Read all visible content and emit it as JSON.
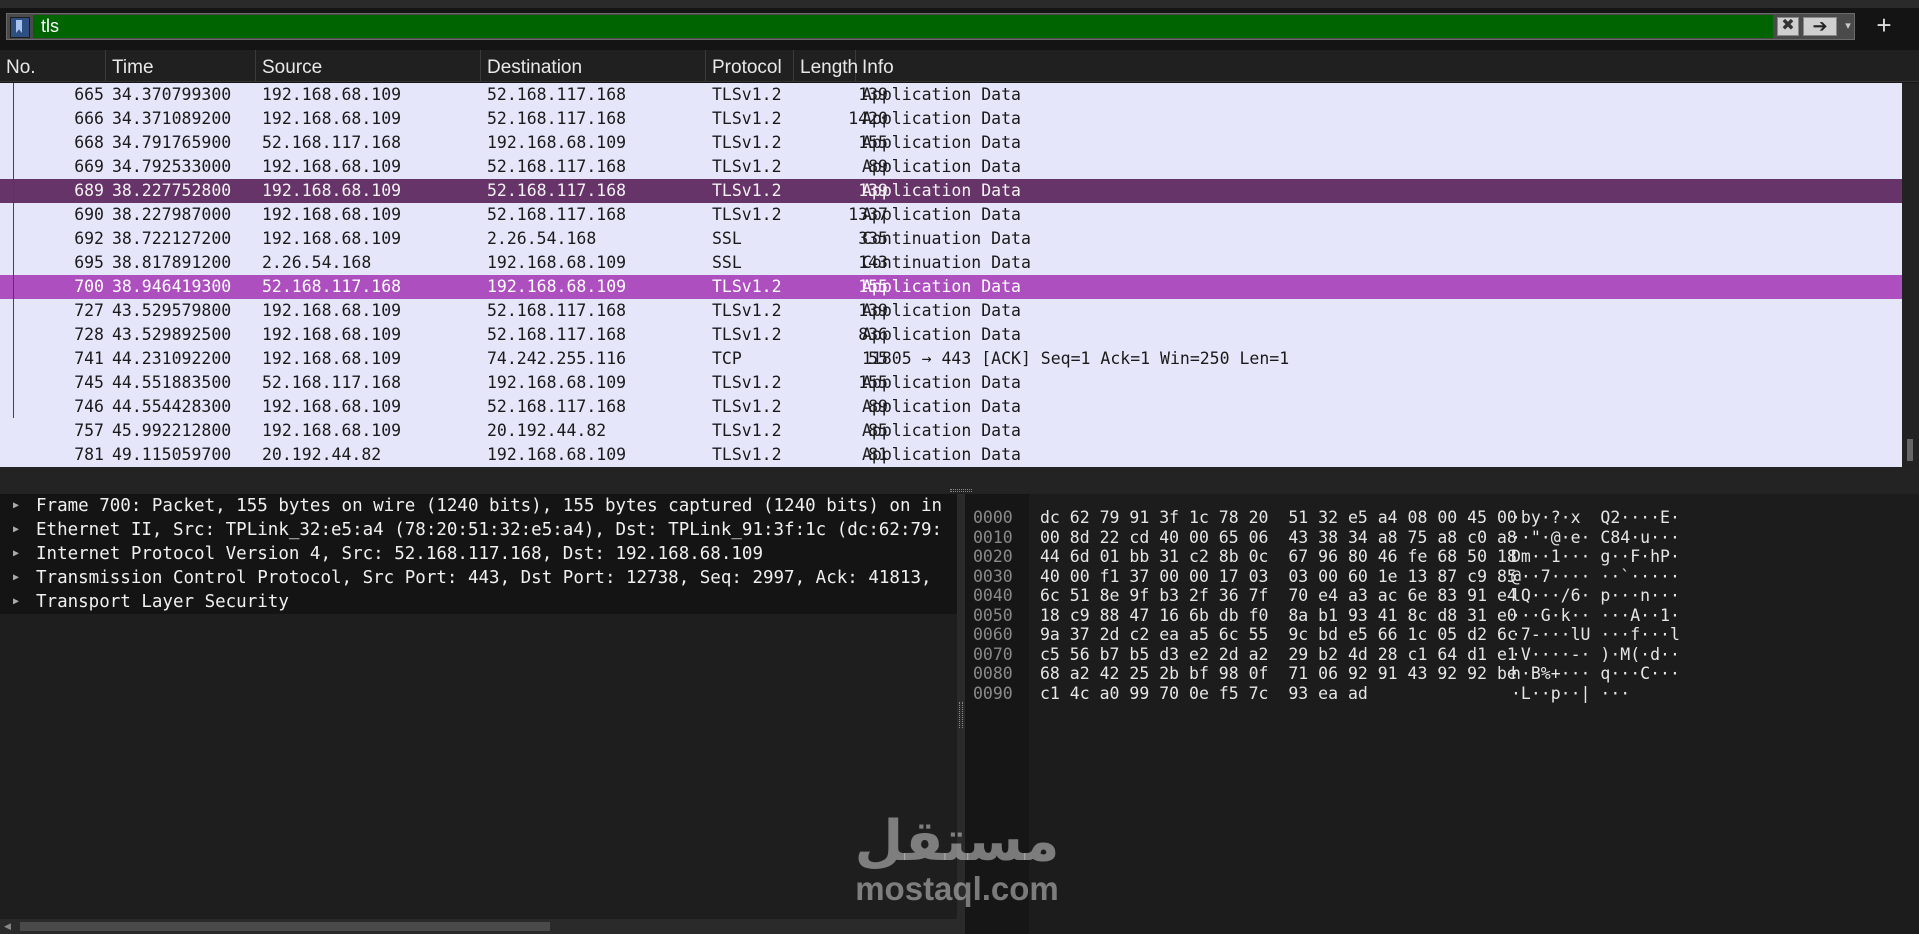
{
  "filter": {
    "value": "tls",
    "clear_icon": "✖",
    "apply_icon": "➔",
    "dropdown_icon": "▾",
    "add_icon": "+"
  },
  "columns": {
    "no": "No.",
    "time": "Time",
    "source": "Source",
    "destination": "Destination",
    "protocol": "Protocol",
    "length": "Length",
    "info": "Info"
  },
  "packets": [
    {
      "no": "665",
      "time": "34.370799300",
      "src": "192.168.68.109",
      "dst": "52.168.117.168",
      "proto": "TLSv1.2",
      "len": "139",
      "info": "Application Data"
    },
    {
      "no": "666",
      "time": "34.371089200",
      "src": "192.168.68.109",
      "dst": "52.168.117.168",
      "proto": "TLSv1.2",
      "len": "1420",
      "info": "Application Data"
    },
    {
      "no": "668",
      "time": "34.791765900",
      "src": "52.168.117.168",
      "dst": "192.168.68.109",
      "proto": "TLSv1.2",
      "len": "155",
      "info": "Application Data"
    },
    {
      "no": "669",
      "time": "34.792533000",
      "src": "192.168.68.109",
      "dst": "52.168.117.168",
      "proto": "TLSv1.2",
      "len": "89",
      "info": "Application Data"
    },
    {
      "no": "689",
      "time": "38.227752800",
      "src": "192.168.68.109",
      "dst": "52.168.117.168",
      "proto": "TLSv1.2",
      "len": "139",
      "info": "Application Data"
    },
    {
      "no": "690",
      "time": "38.227987000",
      "src": "192.168.68.109",
      "dst": "52.168.117.168",
      "proto": "TLSv1.2",
      "len": "1337",
      "info": "Application Data"
    },
    {
      "no": "692",
      "time": "38.722127200",
      "src": "192.168.68.109",
      "dst": "2.26.54.168",
      "proto": "SSL",
      "len": "335",
      "info": "Continuation Data"
    },
    {
      "no": "695",
      "time": "38.817891200",
      "src": "2.26.54.168",
      "dst": "192.168.68.109",
      "proto": "SSL",
      "len": "143",
      "info": "Continuation Data"
    },
    {
      "no": "700",
      "time": "38.946419300",
      "src": "52.168.117.168",
      "dst": "192.168.68.109",
      "proto": "TLSv1.2",
      "len": "155",
      "info": "Application Data"
    },
    {
      "no": "727",
      "time": "43.529579800",
      "src": "192.168.68.109",
      "dst": "52.168.117.168",
      "proto": "TLSv1.2",
      "len": "139",
      "info": "Application Data"
    },
    {
      "no": "728",
      "time": "43.529892500",
      "src": "192.168.68.109",
      "dst": "52.168.117.168",
      "proto": "TLSv1.2",
      "len": "836",
      "info": "Application Data"
    },
    {
      "no": "741",
      "time": "44.231092200",
      "src": "192.168.68.109",
      "dst": "74.242.255.116",
      "proto": "TCP",
      "len": "55",
      "info": "11805 → 443 [ACK] Seq=1 Ack=1 Win=250 Len=1"
    },
    {
      "no": "745",
      "time": "44.551883500",
      "src": "52.168.117.168",
      "dst": "192.168.68.109",
      "proto": "TLSv1.2",
      "len": "155",
      "info": "Application Data"
    },
    {
      "no": "746",
      "time": "44.554428300",
      "src": "192.168.68.109",
      "dst": "52.168.117.168",
      "proto": "TLSv1.2",
      "len": "89",
      "info": "Application Data"
    },
    {
      "no": "757",
      "time": "45.992212800",
      "src": "192.168.68.109",
      "dst": "20.192.44.82",
      "proto": "TLSv1.2",
      "len": "85",
      "info": "Application Data"
    },
    {
      "no": "781",
      "time": "49.115059700",
      "src": "20.192.44.82",
      "dst": "192.168.68.109",
      "proto": "TLSv1.2",
      "len": "81",
      "info": "Application Data"
    }
  ],
  "selected_packet": "700",
  "highlighted_packet": "689",
  "row_colors": {
    "default": "#e6e6fa",
    "selected": "#ad4fbf",
    "highlighted": "#663468"
  },
  "details": [
    "Frame 700: Packet, 155 bytes on wire (1240 bits), 155 bytes captured (1240 bits) on in",
    "Ethernet II, Src: TPLink_32:e5:a4 (78:20:51:32:e5:a4), Dst: TPLink_91:3f:1c (dc:62:79:",
    "Internet Protocol Version 4, Src: 52.168.117.168, Dst: 192.168.68.109",
    "Transmission Control Protocol, Src Port: 443, Dst Port: 12738, Seq: 2997, Ack: 41813,",
    "Transport Layer Security"
  ],
  "bytes": [
    {
      "offset": "0000",
      "hex": "dc 62 79 91 3f 1c 78 20  51 32 e5 a4 08 00 45 00",
      "ascii": "·by·?·x  Q2····E·"
    },
    {
      "offset": "0010",
      "hex": "00 8d 22 cd 40 00 65 06  43 38 34 a8 75 a8 c0 a8",
      "ascii": "··\"·@·e· C84·u···"
    },
    {
      "offset": "0020",
      "hex": "44 6d 01 bb 31 c2 8b 0c  67 96 80 46 fe 68 50 18",
      "ascii": "Dm··1··· g··F·hP·"
    },
    {
      "offset": "0030",
      "hex": "40 00 f1 37 00 00 17 03  03 00 60 1e 13 87 c9 85",
      "ascii": "@··7···· ··`·····"
    },
    {
      "offset": "0040",
      "hex": "6c 51 8e 9f b3 2f 36 7f  70 e4 a3 ac 6e 83 91 e4",
      "ascii": "lQ···/6· p···n···"
    },
    {
      "offset": "0050",
      "hex": "18 c9 88 47 16 6b db f0  8a b1 93 41 8c d8 31 e0",
      "ascii": "···G·k·· ···A··1·"
    },
    {
      "offset": "0060",
      "hex": "9a 37 2d c2 ea a5 6c 55  9c bd e5 66 1c 05 d2 6c",
      "ascii": "·7-···lU ···f···l"
    },
    {
      "offset": "0070",
      "hex": "c5 56 b7 b5 d3 e2 2d a2  29 b2 4d 28 c1 64 d1 e1",
      "ascii": "·V····-· )·M(·d··"
    },
    {
      "offset": "0080",
      "hex": "68 a2 42 25 2b bf 98 0f  71 06 92 91 43 92 92 be",
      "ascii": "h·B%+··· q···C···"
    },
    {
      "offset": "0090",
      "hex": "c1 4c a0 99 70 0e f5 7c  93 ea ad",
      "ascii": "·L··p··| ···"
    }
  ],
  "watermark": {
    "arabic": "مستقل",
    "latin": "mostaql.com"
  }
}
